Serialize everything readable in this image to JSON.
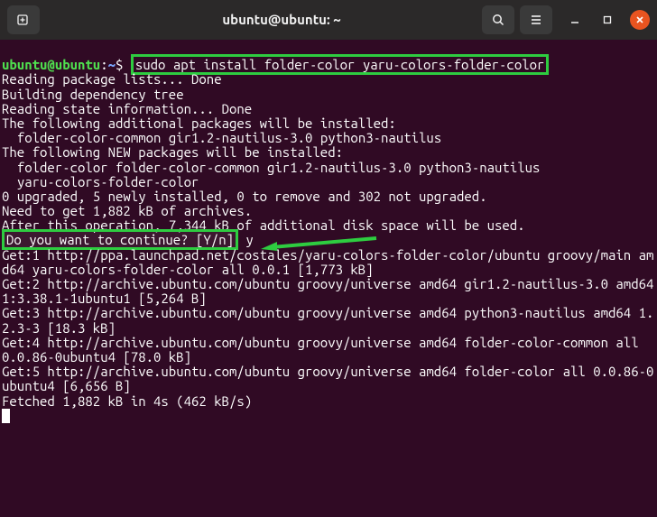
{
  "titlebar": {
    "title": "ubuntu@ubuntu: ~"
  },
  "prompt": {
    "user_host": "ubuntu@ubuntu",
    "path": "~",
    "symbol": "$"
  },
  "command": "sudo apt install folder-color yaru-colors-folder-color",
  "lines": {
    "l1": "Reading package lists... Done",
    "l2": "Building dependency tree",
    "l3": "Reading state information... Done",
    "l4": "The following additional packages will be installed:",
    "l5": "  folder-color-common gir1.2-nautilus-3.0 python3-nautilus",
    "l6": "The following NEW packages will be installed:",
    "l7": "  folder-color folder-color-common gir1.2-nautilus-3.0 python3-nautilus",
    "l8": "  yaru-colors-folder-color",
    "l9": "0 upgraded, 5 newly installed, 0 to remove and 302 not upgraded.",
    "l10": "Need to get 1,882 kB of archives.",
    "l11": "After this operation, 7,344 kB of additional disk space will be used.",
    "l12a": "Do you want to continue? [Y/n]",
    "l12b": " y",
    "l13": "Get:1 http://ppa.launchpad.net/costales/yaru-colors-folder-color/ubuntu groovy/main amd64 yaru-colors-folder-color all 0.0.1 [1,773 kB]",
    "l14": "Get:2 http://archive.ubuntu.com/ubuntu groovy/universe amd64 gir1.2-nautilus-3.0 amd64 1:3.38.1-1ubuntu1 [5,264 B]",
    "l15": "Get:3 http://archive.ubuntu.com/ubuntu groovy/universe amd64 python3-nautilus amd64 1.2.3-3 [18.3 kB]",
    "l16": "Get:4 http://archive.ubuntu.com/ubuntu groovy/universe amd64 folder-color-common all 0.0.86-0ubuntu4 [78.0 kB]",
    "l17": "Get:5 http://archive.ubuntu.com/ubuntu groovy/universe amd64 folder-color all 0.0.86-0ubuntu4 [6,656 B]",
    "l18": "Fetched 1,882 kB in 4s (462 kB/s)"
  }
}
